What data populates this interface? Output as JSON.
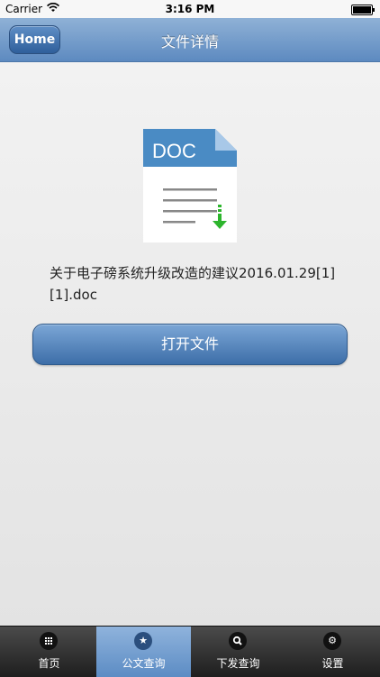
{
  "status_bar": {
    "carrier": "Carrier",
    "time": "3:16 PM",
    "battery_level": 1.0
  },
  "navbar": {
    "back_label": "Home",
    "title": "文件详情"
  },
  "document": {
    "type_label": "DOC",
    "filename": "关于电子磅系统升级改造的建议2016.01.29[1][1].doc"
  },
  "actions": {
    "open_label": "打开文件"
  },
  "tabbar": {
    "tabs": [
      {
        "label": "首页",
        "icon": "grid-icon"
      },
      {
        "label": "公文查询",
        "icon": "star-icon",
        "active": true
      },
      {
        "label": "下发查询",
        "icon": "search-icon"
      },
      {
        "label": "设置",
        "icon": "gear-icon"
      }
    ]
  },
  "colors": {
    "accent": "#5d8ac0",
    "download_arrow": "#2db52d",
    "doc_blue": "#4a8bc4"
  }
}
